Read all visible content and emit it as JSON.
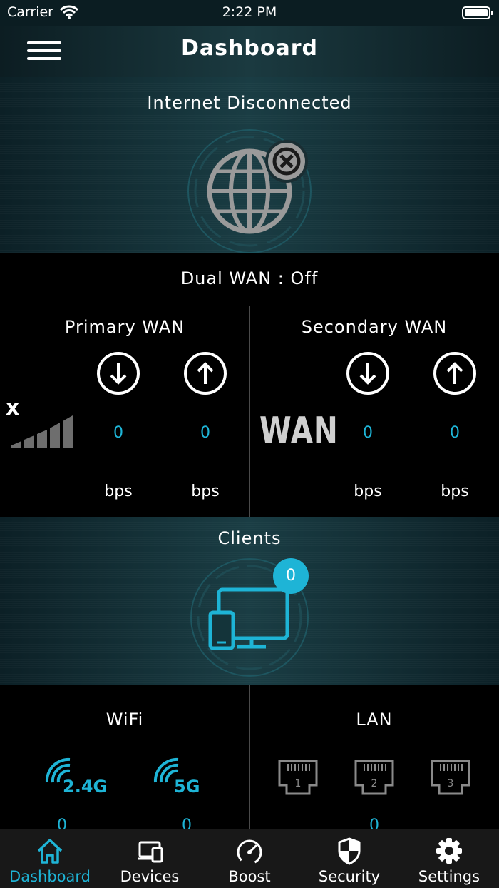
{
  "status_bar": {
    "carrier": "Carrier",
    "time": "2:22 PM"
  },
  "nav": {
    "title": "Dashboard"
  },
  "internet": {
    "status": "Internet Disconnected"
  },
  "dual_wan": {
    "label": "Dual WAN : Off",
    "primary": {
      "title": "Primary WAN",
      "signal_mark": "x",
      "download": "0",
      "upload": "0",
      "download_unit": "bps",
      "upload_unit": "bps"
    },
    "secondary": {
      "title": "Secondary WAN",
      "badge": "WAN",
      "download": "0",
      "upload": "0",
      "download_unit": "bps",
      "upload_unit": "bps"
    }
  },
  "clients": {
    "title": "Clients",
    "count": "0"
  },
  "wifi": {
    "title": "WiFi",
    "band_24": "2.4G",
    "band_5": "5G",
    "count_24": "0",
    "count_5": "0"
  },
  "lan": {
    "title": "LAN",
    "ports": [
      "1",
      "2",
      "3"
    ],
    "count": "0"
  },
  "tabs": [
    {
      "label": "Dashboard",
      "icon": "home-icon",
      "active": true
    },
    {
      "label": "Devices",
      "icon": "devices-icon",
      "active": false
    },
    {
      "label": "Boost",
      "icon": "speedometer-icon",
      "active": false
    },
    {
      "label": "Security",
      "icon": "shield-icon",
      "active": false
    },
    {
      "label": "Settings",
      "icon": "gear-icon",
      "active": false
    }
  ],
  "colors": {
    "accent": "#1eb4d6",
    "tab_bar": "#181818",
    "section_dark": "#000000"
  }
}
